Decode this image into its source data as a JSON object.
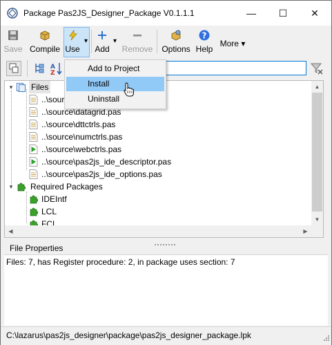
{
  "window": {
    "title": "Package Pas2JS_Designer_Package V0.1.1.1",
    "minimize_glyph": "—",
    "maximize_glyph": "☐",
    "close_glyph": "✕"
  },
  "toolbar": {
    "save_label": "Save",
    "compile_label": "Compile",
    "use_label": "Use",
    "add_label": "Add",
    "remove_label": "Remove",
    "options_label": "Options",
    "help_label": "Help",
    "more_label": "More",
    "dropdown_glyph": "▾"
  },
  "filter": {
    "value": "",
    "placeholder": ""
  },
  "tree": {
    "files_node": "Files",
    "files": [
      "..\\source\\",
      "..\\source\\datagrid.pas",
      "..\\source\\dttctrls.pas",
      "..\\source\\numctrls.pas",
      "..\\source\\webctrls.pas",
      "..\\source\\pas2js_ide_descriptor.pas",
      "..\\source\\pas2js_ide_options.pas"
    ],
    "required_node": "Required Packages",
    "packages": [
      "IDEIntf",
      "LCL",
      "FCL"
    ]
  },
  "properties": {
    "title": "File Properties",
    "summary": "Files: 7, has Register procedure: 2, in package uses section: 7"
  },
  "status": {
    "path": "C:\\lazarus\\pas2js_designer\\package\\pas2js_designer_package.lpk"
  },
  "use_menu": {
    "items": [
      "Add to Project",
      "Install",
      "Uninstall"
    ],
    "highlighted": "Install"
  },
  "icons": {
    "unit_register": "unit-file-register-icon",
    "unit": "unit-file-icon",
    "package": "package-puzzle-icon"
  },
  "colors": {
    "highlight": "#91c9f7",
    "focus_border": "#0078d7",
    "package_green": "#3aa22b"
  }
}
